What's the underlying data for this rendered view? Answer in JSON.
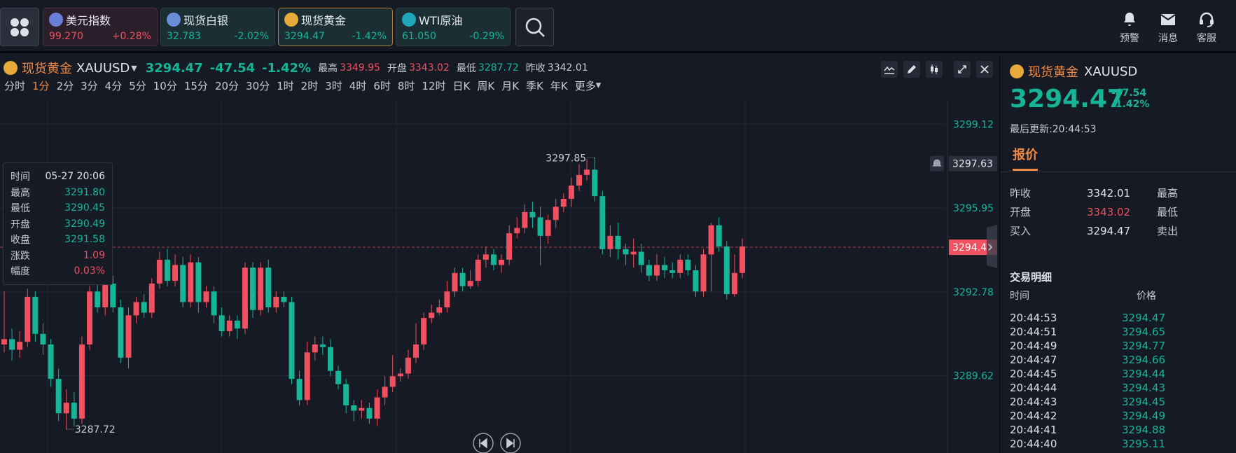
{
  "topbar": {
    "tickers": [
      {
        "name": "美元指数",
        "price": "99.270",
        "change": "+0.28%",
        "price_color": "#f0505f",
        "change_color": "#f0505f",
        "bg": "#2a1f2b",
        "border": "#4a3040",
        "icon": "us-flag-icon"
      },
      {
        "name": "现货白银",
        "price": "32.783",
        "change": "-2.02%",
        "price_color": "#16b597",
        "change_color": "#16b597",
        "bg": "#1a2e33",
        "border": "#2d4045",
        "icon": "silver-coin-icon"
      },
      {
        "name": "现货黄金",
        "price": "3294.47",
        "change": "-1.42%",
        "price_color": "#16b597",
        "change_color": "#16b597",
        "bg": "#1a2e33",
        "border": "#b07a3a",
        "icon": "gold-coin-icon"
      },
      {
        "name": "WTI原油",
        "price": "61.050",
        "change": "-0.29%",
        "price_color": "#16b597",
        "change_color": "#16b597",
        "bg": "#1a2e33",
        "border": "#2d4045",
        "icon": "oil-icon"
      }
    ],
    "actions": [
      {
        "label": "预警",
        "icon": "bell-icon"
      },
      {
        "label": "消息",
        "icon": "mail-icon"
      },
      {
        "label": "客服",
        "icon": "headset-icon"
      }
    ]
  },
  "chart_header": {
    "name": "现货黄金",
    "symbol": "XAUUSD",
    "price": "3294.47",
    "change": "-47.54",
    "change_pct": "-1.42%",
    "high_label": "最高",
    "high": "3349.95",
    "open_label": "开盘",
    "open": "3343.02",
    "low_label": "最低",
    "low": "3287.72",
    "prev_label": "昨收",
    "prev": "3342.01"
  },
  "intervals": [
    "分时",
    "1分",
    "2分",
    "3分",
    "4分",
    "5分",
    "10分",
    "15分",
    "20分",
    "30分",
    "1时",
    "2时",
    "3时",
    "4时",
    "6时",
    "8时",
    "12时",
    "日K",
    "周K",
    "月K",
    "季K",
    "年K",
    "更多"
  ],
  "active_interval": "1分",
  "infobox": [
    {
      "k": "时间",
      "v": "05-27 20:06",
      "c": "#e0e3ea"
    },
    {
      "k": "最高",
      "v": "3291.80",
      "c": "#16b597"
    },
    {
      "k": "最低",
      "v": "3290.45",
      "c": "#16b597"
    },
    {
      "k": "开盘",
      "v": "3290.49",
      "c": "#16b597"
    },
    {
      "k": "收盘",
      "v": "3291.58",
      "c": "#16b597"
    },
    {
      "k": "涨跌",
      "v": "1.09",
      "c": "#f0505f"
    },
    {
      "k": "幅度",
      "v": "0.03%",
      "c": "#f0505f"
    }
  ],
  "chart_data": {
    "type": "candlestick",
    "ylim": [
      3286.7,
      3300.0
    ],
    "y_ticks": [
      "3299.12",
      "3295.95",
      "3292.78",
      "3289.62"
    ],
    "marker_high": "3297.85",
    "marker_low": "3287.72",
    "alert_price": "3297.63",
    "current_price": "3294.47",
    "candles": [
      [
        3290.8,
        3291.0,
        3292.8,
        3290.5
      ],
      [
        3291.0,
        3290.6,
        3291.4,
        3290.2
      ],
      [
        3290.6,
        3290.9,
        3291.3,
        3290.3
      ],
      [
        3290.9,
        3292.6,
        3292.9,
        3290.7
      ],
      [
        3292.6,
        3291.2,
        3292.8,
        3290.9
      ],
      [
        3291.2,
        3290.8,
        3291.6,
        3290.4
      ],
      [
        3290.8,
        3289.5,
        3291.0,
        3289.2
      ],
      [
        3289.5,
        3288.2,
        3289.9,
        3287.9
      ],
      [
        3288.2,
        3288.6,
        3289.1,
        3287.6
      ],
      [
        3288.6,
        3288.0,
        3289.0,
        3287.7
      ],
      [
        3288.0,
        3290.8,
        3291.1,
        3287.8
      ],
      [
        3290.8,
        3292.8,
        3293.0,
        3290.6
      ],
      [
        3292.8,
        3292.2,
        3293.6,
        3292.0
      ],
      [
        3292.2,
        3293.1,
        3293.3,
        3291.9
      ],
      [
        3293.1,
        3292.2,
        3293.4,
        3292.0
      ],
      [
        3292.2,
        3290.3,
        3292.5,
        3290.1
      ],
      [
        3290.3,
        3291.9,
        3292.2,
        3289.9
      ],
      [
        3291.9,
        3292.4,
        3292.6,
        3291.6
      ],
      [
        3292.4,
        3292.0,
        3292.7,
        3291.8
      ],
      [
        3292.0,
        3293.1,
        3293.3,
        3291.8
      ],
      [
        3293.1,
        3294.0,
        3294.3,
        3292.9
      ],
      [
        3294.0,
        3293.2,
        3294.4,
        3293.0
      ],
      [
        3293.2,
        3293.8,
        3294.2,
        3293.0
      ],
      [
        3293.8,
        3292.4,
        3294.1,
        3292.2
      ],
      [
        3292.4,
        3293.9,
        3294.2,
        3292.2
      ],
      [
        3293.9,
        3292.4,
        3294.1,
        3292.0
      ],
      [
        3292.4,
        3292.8,
        3293.0,
        3292.2
      ],
      [
        3292.8,
        3291.9,
        3293.0,
        3291.6
      ],
      [
        3291.9,
        3291.3,
        3292.2,
        3291.1
      ],
      [
        3291.3,
        3291.7,
        3291.9,
        3291.1
      ],
      [
        3291.7,
        3291.4,
        3291.9,
        3291.0
      ],
      [
        3291.4,
        3293.7,
        3293.9,
        3291.2
      ],
      [
        3293.7,
        3292.1,
        3293.9,
        3291.8
      ],
      [
        3292.1,
        3293.7,
        3293.9,
        3291.9
      ],
      [
        3293.7,
        3292.2,
        3294.0,
        3292.0
      ],
      [
        3292.2,
        3292.6,
        3292.8,
        3292.0
      ],
      [
        3292.6,
        3292.4,
        3292.8,
        3292.2
      ],
      [
        3292.4,
        3289.5,
        3292.6,
        3289.3
      ],
      [
        3289.5,
        3288.7,
        3289.8,
        3288.5
      ],
      [
        3288.7,
        3290.5,
        3290.9,
        3288.5
      ],
      [
        3290.5,
        3290.8,
        3291.1,
        3290.2
      ],
      [
        3290.8,
        3290.7,
        3291.1,
        3290.4
      ],
      [
        3290.7,
        3289.8,
        3291.0,
        3289.6
      ],
      [
        3289.8,
        3289.3,
        3290.0,
        3289.1
      ],
      [
        3289.3,
        3288.5,
        3289.5,
        3288.2
      ],
      [
        3288.5,
        3288.3,
        3288.7,
        3287.9
      ],
      [
        3288.3,
        3288.4,
        3288.7,
        3288.0
      ],
      [
        3288.4,
        3288.0,
        3288.6,
        3287.8
      ],
      [
        3288.0,
        3288.8,
        3289.1,
        3287.72
      ],
      [
        3288.8,
        3289.2,
        3289.6,
        3288.5
      ],
      [
        3289.2,
        3289.6,
        3290.4,
        3289.0
      ],
      [
        3289.6,
        3289.7,
        3289.9,
        3289.4
      ],
      [
        3289.7,
        3290.3,
        3290.6,
        3289.5
      ],
      [
        3290.3,
        3290.8,
        3291.6,
        3290.1
      ],
      [
        3290.8,
        3291.8,
        3292.0,
        3290.6
      ],
      [
        3291.8,
        3292.0,
        3292.3,
        3291.6
      ],
      [
        3292.0,
        3292.2,
        3292.5,
        3291.9
      ],
      [
        3292.2,
        3292.8,
        3293.2,
        3292.0
      ],
      [
        3292.8,
        3293.5,
        3293.7,
        3292.6
      ],
      [
        3293.5,
        3293.0,
        3293.7,
        3292.8
      ],
      [
        3293.0,
        3293.2,
        3293.6,
        3292.9
      ],
      [
        3293.2,
        3294.0,
        3294.2,
        3293.0
      ],
      [
        3294.0,
        3294.2,
        3294.5,
        3293.7
      ],
      [
        3294.2,
        3293.8,
        3294.4,
        3293.6
      ],
      [
        3293.8,
        3294.0,
        3294.2,
        3293.5
      ],
      [
        3294.0,
        3295.0,
        3295.3,
        3293.8
      ],
      [
        3295.0,
        3295.2,
        3295.6,
        3294.8
      ],
      [
        3295.2,
        3295.8,
        3296.1,
        3295.0
      ],
      [
        3295.8,
        3295.6,
        3296.2,
        3295.2
      ],
      [
        3295.6,
        3294.9,
        3296.0,
        3293.8
      ],
      [
        3294.9,
        3295.5,
        3295.7,
        3294.6
      ],
      [
        3295.5,
        3296.0,
        3296.3,
        3295.2
      ],
      [
        3296.0,
        3296.3,
        3296.5,
        3295.8
      ],
      [
        3296.3,
        3296.8,
        3297.1,
        3296.0
      ],
      [
        3296.8,
        3297.2,
        3297.6,
        3296.6
      ],
      [
        3297.2,
        3297.4,
        3297.8,
        3297.0
      ],
      [
        3297.4,
        3296.4,
        3297.85,
        3296.2
      ],
      [
        3296.4,
        3294.4,
        3296.6,
        3294.2
      ],
      [
        3294.4,
        3294.9,
        3295.3,
        3294.1
      ],
      [
        3294.9,
        3294.4,
        3295.4,
        3294.0
      ],
      [
        3294.4,
        3294.2,
        3294.6,
        3293.8
      ],
      [
        3294.2,
        3294.3,
        3294.8,
        3293.7
      ],
      [
        3294.3,
        3293.8,
        3294.6,
        3293.5
      ],
      [
        3293.8,
        3293.4,
        3294.0,
        3293.2
      ],
      [
        3293.4,
        3293.8,
        3294.2,
        3293.2
      ],
      [
        3293.8,
        3293.6,
        3294.1,
        3293.3
      ],
      [
        3293.6,
        3293.5,
        3293.9,
        3293.3
      ],
      [
        3293.5,
        3294.0,
        3294.2,
        3293.3
      ],
      [
        3294.0,
        3293.6,
        3294.2,
        3293.4
      ],
      [
        3293.6,
        3292.8,
        3293.8,
        3292.6
      ],
      [
        3292.8,
        3294.2,
        3294.4,
        3292.6
      ],
      [
        3294.2,
        3295.3,
        3295.4,
        3292.8
      ],
      [
        3295.3,
        3294.5,
        3295.6,
        3294.3
      ],
      [
        3294.5,
        3292.7,
        3294.7,
        3292.5
      ],
      [
        3292.7,
        3293.5,
        3294.2,
        3292.6
      ],
      [
        3293.5,
        3294.5,
        3294.8,
        3293.3
      ]
    ]
  },
  "side": {
    "name": "现货黄金",
    "symbol": "XAUUSD",
    "price": "3294.47",
    "change": "-47.54",
    "change_pct": "-1.42%",
    "updated": "最后更新:20:44:53",
    "tab": "报价",
    "quotes": [
      {
        "k": "昨收",
        "v": "3342.01",
        "c": "#e0e3ea",
        "k2": "最高"
      },
      {
        "k": "开盘",
        "v": "3343.02",
        "c": "#f0505f",
        "k2": "最低"
      },
      {
        "k": "买入",
        "v": "3294.47",
        "c": "#e0e3ea",
        "k2": "卖出"
      }
    ],
    "trades_title": "交易明细",
    "col_time": "时间",
    "col_price": "价格",
    "trades": [
      {
        "t": "20:44:53",
        "p": "3294.47"
      },
      {
        "t": "20:44:51",
        "p": "3294.65"
      },
      {
        "t": "20:44:49",
        "p": "3294.77"
      },
      {
        "t": "20:44:47",
        "p": "3294.66"
      },
      {
        "t": "20:44:45",
        "p": "3294.44"
      },
      {
        "t": "20:44:44",
        "p": "3294.43"
      },
      {
        "t": "20:44:43",
        "p": "3294.45"
      },
      {
        "t": "20:44:42",
        "p": "3294.49"
      },
      {
        "t": "20:44:41",
        "p": "3294.88"
      },
      {
        "t": "20:44:40",
        "p": "3295.11"
      }
    ]
  },
  "colors": {
    "up": "#f0505f",
    "down": "#16b597",
    "accent": "#f08a44"
  }
}
